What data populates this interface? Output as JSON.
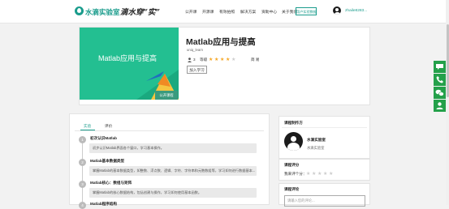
{
  "header": {
    "brand": "水滴实验室",
    "slogan": "滴水穿“实”",
    "nav": [
      "公开课",
      "开源课",
      "有效拍照",
      "解决方案",
      "资助中心",
      "关于我们"
    ],
    "sandbox_button": "用户实验数据",
    "username": "zhaile8283..."
  },
  "course": {
    "cover_title": "Matlab应用与提高",
    "cover_tag": "公开课程",
    "title": "Matlab应用与提高",
    "author": "uniq_learn",
    "learners": "3",
    "level_label": "等级",
    "stars": 4,
    "difficulty": "简 易",
    "join_button": "加入学习"
  },
  "tabs": [
    "实验",
    "评价"
  ],
  "chapters": [
    {
      "num": "1",
      "title": "初次认识Matlab",
      "desc": "初步认识Matlab界面各个窗口，学习基本操作。"
    },
    {
      "num": "2",
      "title": "Matlab基本数据类型",
      "desc": "掌握Matlab的基本数据类型，如整数、浮点数、逻辑、字符、字符串和元胞数组等，学习如何进行数据基本..."
    },
    {
      "num": "3",
      "title": "Matlab核心：数组与矩阵",
      "desc": "掌握Matlab的核心数据结构，包括创建与操作，学习如何使用基本函数。"
    },
    {
      "num": "4",
      "title": "Matlab程序结构",
      "desc": ""
    }
  ],
  "sidebar": {
    "author_panel_title": "课程制作方",
    "author_name": "水滴实验室",
    "author_org": "水滴实验室",
    "rating_panel_title": "课程评分",
    "rating_label": "我来评个分：",
    "comment_panel_title": "课程评论",
    "comment_placeholder": "请输入您的评论..."
  },
  "float_icons": [
    "chat-icon",
    "phone-icon",
    "wechat-icon",
    "profile-icon"
  ],
  "colors": {
    "accent": "#1a9c8c",
    "cover": "#23bf91",
    "float": "#24a04a",
    "star": "#f5a623"
  }
}
